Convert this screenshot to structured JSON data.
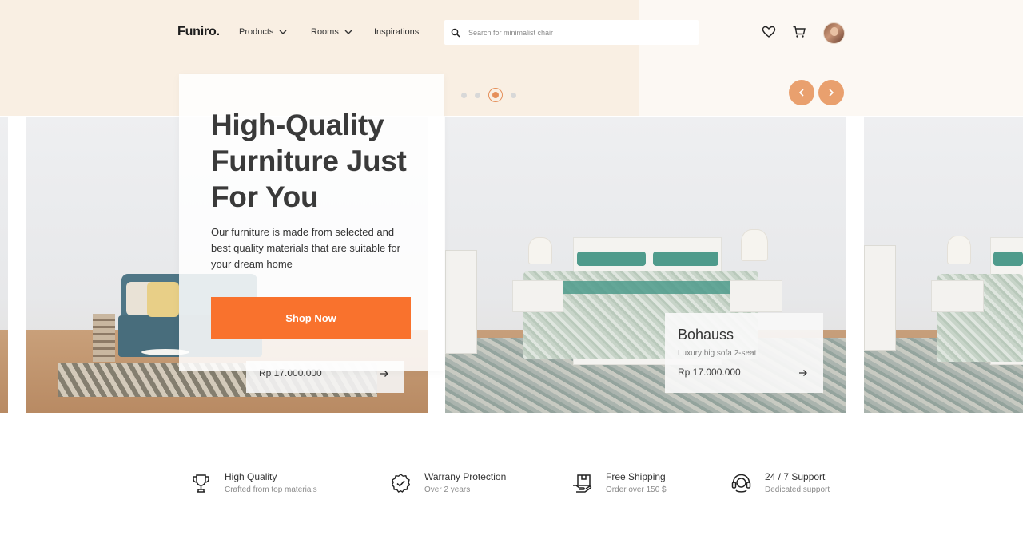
{
  "header": {
    "logo": "Funiro.",
    "nav": [
      {
        "label": "Products"
      },
      {
        "label": "Rooms"
      },
      {
        "label": "Inspirations"
      }
    ],
    "search_placeholder": "Search for minimalist chair"
  },
  "carousel": {
    "slide_count": 4,
    "active_index": 2
  },
  "hero": {
    "title": "High-Quality Furniture Just For You",
    "description": "Our furniture is made from selected and best quality materials that are suitable for your dream home",
    "button_label": "Shop Now"
  },
  "products": [
    {
      "price": "Rp 17.000.000"
    },
    {
      "name": "Bohauss",
      "subtitle": "Luxury big sofa 2-seat",
      "price": "Rp 17.000.000"
    }
  ],
  "features": [
    {
      "icon": "trophy-icon",
      "title": "High Quality",
      "subtitle": "Crafted from top materials"
    },
    {
      "icon": "check-badge-icon",
      "title": "Warrany Protection",
      "subtitle": "Over 2 years"
    },
    {
      "icon": "shipping-box-icon",
      "title": "Free Shipping",
      "subtitle": "Order over 150 $"
    },
    {
      "icon": "headset-icon",
      "title": "24 / 7 Support",
      "subtitle": "Dedicated support"
    }
  ],
  "colors": {
    "accent": "#f9722d",
    "arrow_bg": "#e9a06e",
    "dot_active": "#e58f5a",
    "beige_bg": "#f9efe3"
  }
}
